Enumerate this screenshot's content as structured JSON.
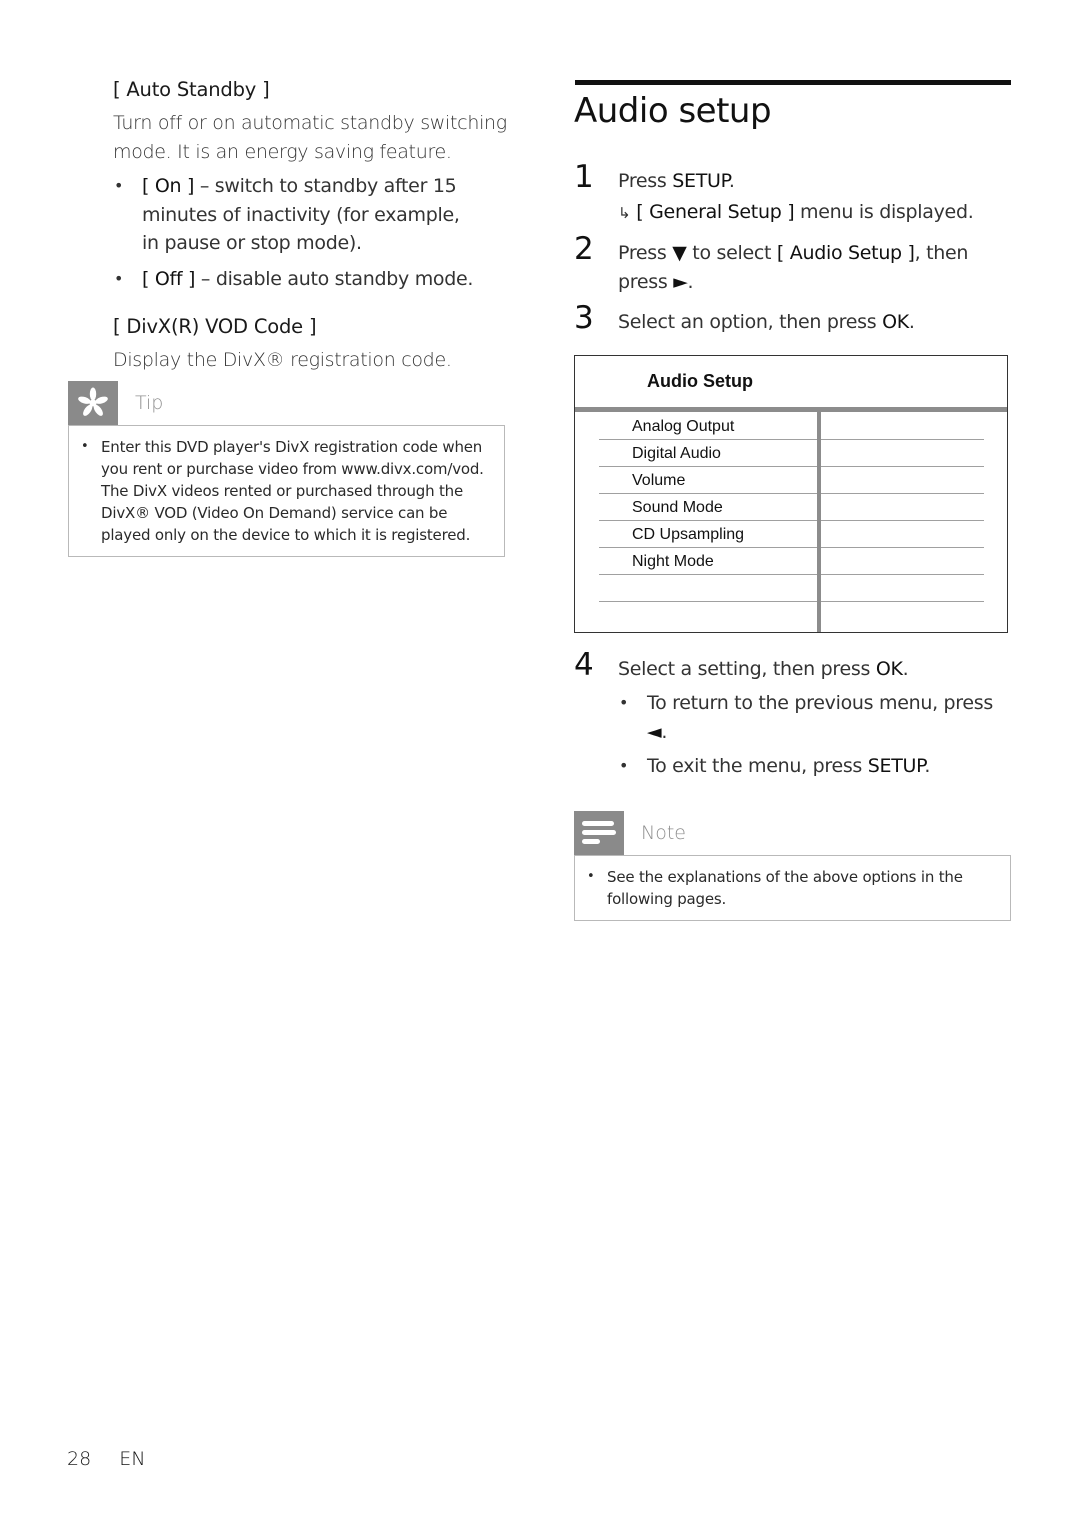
{
  "left": {
    "auto_standby": {
      "title": "[ Auto Standby ]",
      "description": "Turn off or on automatic standby switching mode. It is an energy saving feature.",
      "options": [
        {
          "key": "[ On ]",
          "text": " – switch to standby after 15 minutes of inactivity (for example, in pause or stop mode)."
        },
        {
          "key": "[ Off ]",
          "text": " – disable auto standby mode."
        }
      ]
    },
    "divx_vod": {
      "title": "[ DivX(R) VOD Code ]",
      "description": "Display the DivX® registration code."
    },
    "tip": {
      "icon": "asterisk-icon",
      "label": "Tip",
      "items": [
        "Enter this DVD player's DivX registration code when you rent or purchase video from www.divx.com/vod. The DivX videos rented or purchased through the DivX® VOD (Video On Demand) service can be played only on the device to which it is registered."
      ]
    }
  },
  "right": {
    "title": "Audio setup",
    "steps": [
      {
        "num": "1",
        "pre": "Press ",
        "kw": "SETUP",
        "post": ".",
        "result_arrow": "↳",
        "result_kw": "[ General Setup ]",
        "result_text": " menu is displayed."
      },
      {
        "num": "2",
        "pre": "Press ",
        "arrow_down": "▼",
        "mid": " to select ",
        "kw": "[ Audio Setup ]",
        "post": ", then press ",
        "arrow_right": "►",
        "end": "."
      },
      {
        "num": "3",
        "pre": "Select an option, then press ",
        "kw": "OK",
        "post": "."
      },
      {
        "num": "4",
        "pre": "Select a setting, then press ",
        "kw": "OK",
        "post": "."
      }
    ],
    "step4_bullets": [
      {
        "pre": "To return to the previous menu, press ",
        "arrow": "◄",
        "post": "."
      },
      {
        "pre": "To exit the menu, press ",
        "kw": "SETUP",
        "post": "."
      }
    ],
    "menu": {
      "title": "Audio Setup",
      "items": [
        "Analog Output",
        "Digital Audio",
        "Volume",
        "Sound Mode",
        "CD Upsampling",
        "Night Mode",
        ""
      ]
    },
    "note": {
      "icon": "note-lines-icon",
      "label": "Note",
      "items": [
        "See the explanations of the above options in the following pages."
      ]
    }
  },
  "footer": {
    "page_number": "28",
    "language": "EN"
  }
}
